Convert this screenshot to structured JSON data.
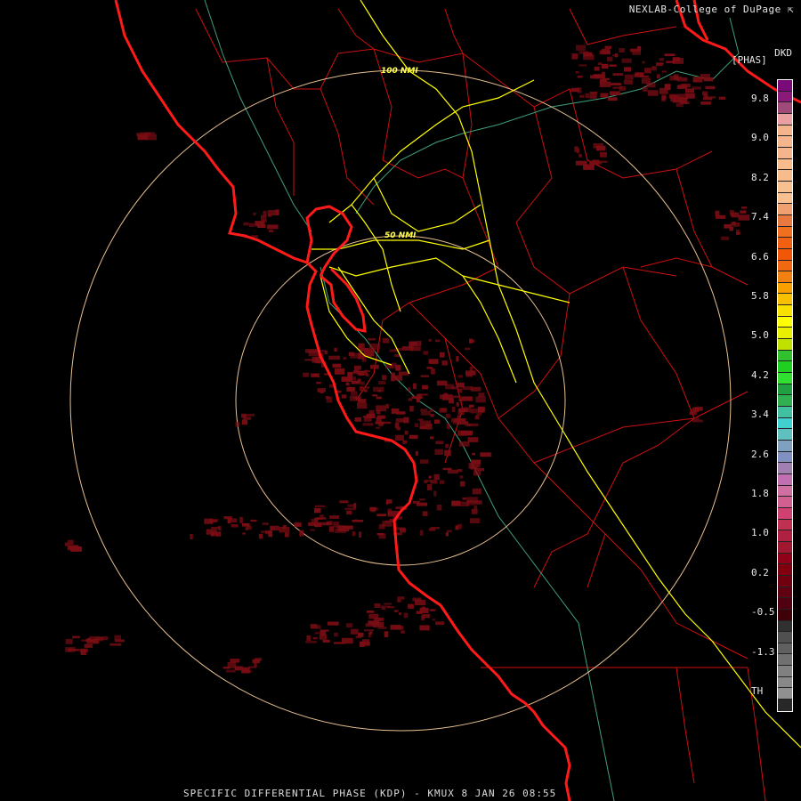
{
  "header": {
    "credit": "NEXLAB-College of DuPage",
    "credit_icon": "external-link-icon"
  },
  "legend": {
    "product": "DKD",
    "unit": "[PHAS]",
    "labels": [
      "9.8",
      "9.0",
      "8.2",
      "7.4",
      "6.6",
      "5.8",
      "5.0",
      "4.2",
      "3.4",
      "2.6",
      "1.8",
      "1.0",
      "0.2",
      "-0.5",
      "-1.3",
      "TH"
    ],
    "swatches": [
      "#7a0a7a",
      "#8a1a7a",
      "#a04a7a",
      "#e8a0a0",
      "#f4b48c",
      "#f4b48c",
      "#f4b48c",
      "#f8bc8c",
      "#f8bc8c",
      "#f8c090",
      "#f8c090",
      "#f0a070",
      "#e87840",
      "#f07020",
      "#f06010",
      "#f05808",
      "#f06810",
      "#f08010",
      "#f8a000",
      "#f8c000",
      "#f8e000",
      "#ffff00",
      "#e8f000",
      "#c0e000",
      "#30c030",
      "#20d020",
      "#30e030",
      "#20a040",
      "#30b050",
      "#40c0a0",
      "#40d0d0",
      "#60c0c0",
      "#80a0c0",
      "#8090c0",
      "#a080b0",
      "#c070b0",
      "#d070a0",
      "#d06090",
      "#d04070",
      "#c03050",
      "#b02040",
      "#a01830",
      "#900018",
      "#800010",
      "#700010",
      "#600010",
      "#500010",
      "#400008",
      "#303030",
      "#505050",
      "#606060",
      "#707070",
      "#808080",
      "#888888",
      "#909090",
      "#282828"
    ]
  },
  "map": {
    "ring_labels": [
      "100 NMI",
      "50 NMI"
    ],
    "colors": {
      "coast": "#ff1a1a",
      "county": "#cc1010",
      "highway": "#ffff00",
      "river": "#3fa07a",
      "ring": "#e8c090",
      "echo": "#7a0d14"
    }
  },
  "caption": "SPECIFIC DIFFERENTIAL PHASE (KDP) - KMUX 8 JAN 26 08:55"
}
